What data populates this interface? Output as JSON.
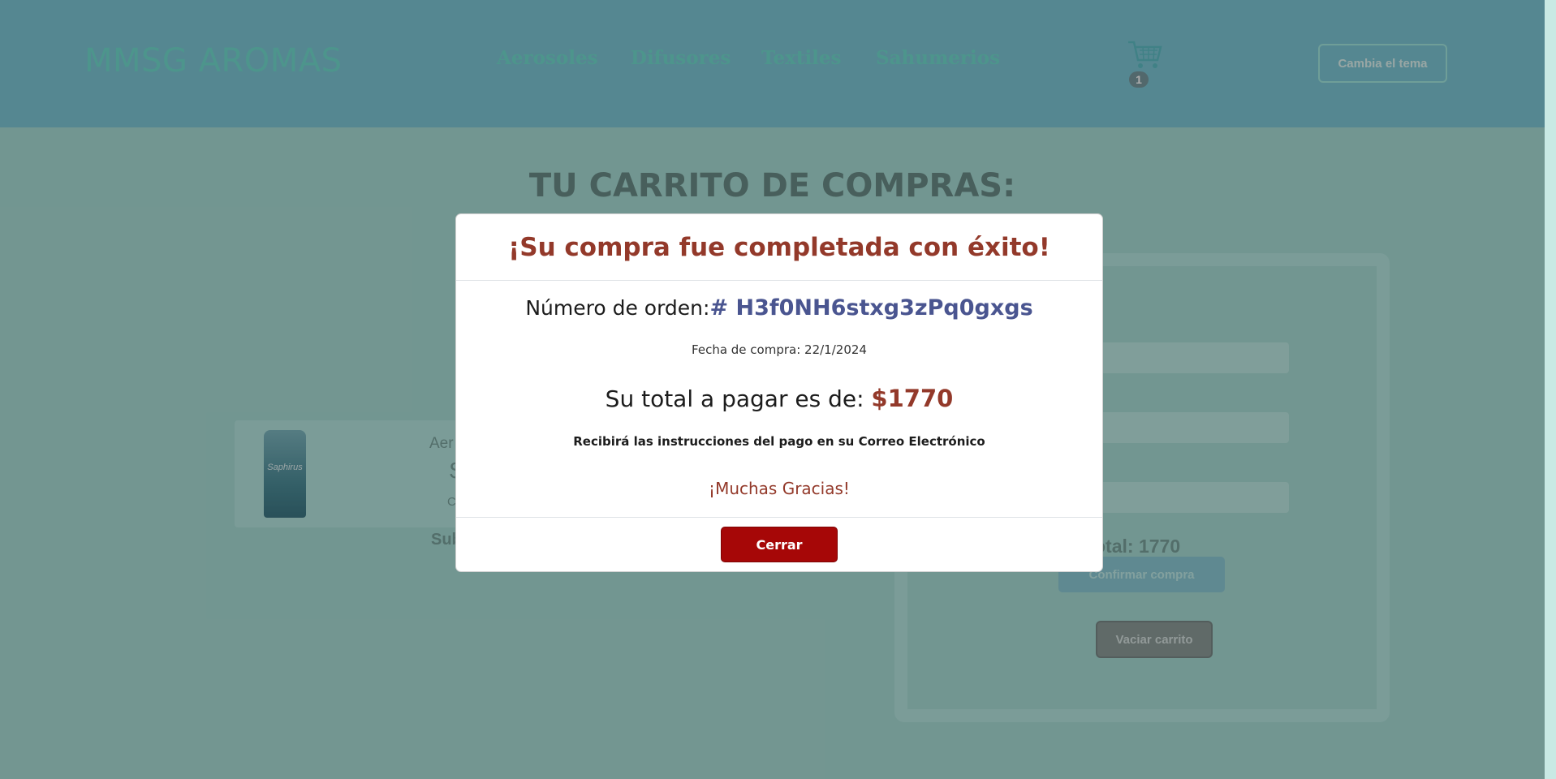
{
  "navbar": {
    "brand": "MMSG AROMAS",
    "links": [
      "Aerosoles",
      "Difusores",
      "Textiles",
      "Sahumerios"
    ],
    "cart_count": "1",
    "theme_button": "Cambia el tema",
    "cart_icon": "shopping-cart-icon"
  },
  "cart_page": {
    "title": "TU CARRITO DE COMPRAS:",
    "product": {
      "name": "Aer",
      "price": "$",
      "qty": "C",
      "image_label": "Saphirus"
    },
    "subtotal_label": "Sub",
    "form": {
      "email_placeholder_fragment": "m",
      "total": "otal: 1770",
      "confirm_button": "Confirmar compra",
      "empty_button": "Vaciar carrito"
    }
  },
  "modal": {
    "title": "¡Su compra fue completada con éxito!",
    "order_label": "Número de orden:",
    "order_id": "# H3f0NH6stxg3zPq0gxgs",
    "date_line": "Fecha de compra: 22/1/2024",
    "total_label": "Su total a pagar es de: ",
    "total_amount": "$1770",
    "instructions": "Recibirá las instrucciones del pago en su Correo Electrónico",
    "thanks": "¡Muchas Gracias!",
    "close_button": "Cerrar"
  },
  "colors": {
    "accent_red": "#93392a",
    "order_blue": "#4a5590",
    "close_button": "#a60707",
    "navbar_bg": "#7ec8d6"
  }
}
